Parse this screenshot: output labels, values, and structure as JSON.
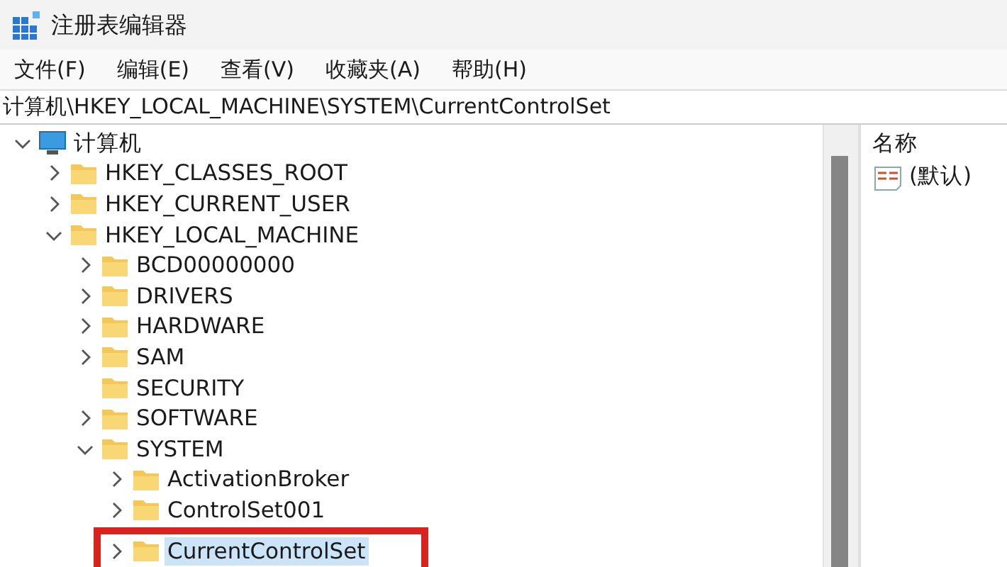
{
  "window": {
    "title": "注册表编辑器"
  },
  "menu": [
    "文件(F)",
    "编辑(E)",
    "查看(V)",
    "收藏夹(A)",
    "帮助(H)"
  ],
  "address": "计算机\\HKEY_LOCAL_MACHINE\\SYSTEM\\CurrentControlSet",
  "tree": [
    {
      "label": "计算机",
      "kind": "computer",
      "expanded": true,
      "selected": false,
      "children": [
        {
          "label": "HKEY_CLASSES_ROOT",
          "kind": "folder",
          "expanded": false,
          "selected": false
        },
        {
          "label": "HKEY_CURRENT_USER",
          "kind": "folder",
          "expanded": false,
          "selected": false
        },
        {
          "label": "HKEY_LOCAL_MACHINE",
          "kind": "folder",
          "expanded": true,
          "selected": false,
          "children": [
            {
              "label": "BCD00000000",
              "kind": "folder",
              "expanded": false,
              "selected": false
            },
            {
              "label": "DRIVERS",
              "kind": "folder",
              "expanded": false,
              "selected": false
            },
            {
              "label": "HARDWARE",
              "kind": "folder",
              "expanded": false,
              "selected": false
            },
            {
              "label": "SAM",
              "kind": "folder",
              "expanded": false,
              "selected": false
            },
            {
              "label": "SECURITY",
              "kind": "leaf",
              "selected": false
            },
            {
              "label": "SOFTWARE",
              "kind": "folder",
              "expanded": false,
              "selected": false
            },
            {
              "label": "SYSTEM",
              "kind": "folder",
              "expanded": true,
              "selected": false,
              "children": [
                {
                  "label": "ActivationBroker",
                  "kind": "folder",
                  "expanded": false,
                  "selected": false
                },
                {
                  "label": "ControlSet001",
                  "kind": "folder",
                  "expanded": false,
                  "selected": false
                },
                {
                  "label": "CurrentControlSet",
                  "kind": "folder",
                  "expanded": false,
                  "selected": true,
                  "highlighted": true
                }
              ]
            }
          ]
        }
      ]
    }
  ],
  "values": {
    "columns": [
      "名称"
    ],
    "rows": [
      {
        "name": "(默认)",
        "kind": "string"
      }
    ]
  }
}
